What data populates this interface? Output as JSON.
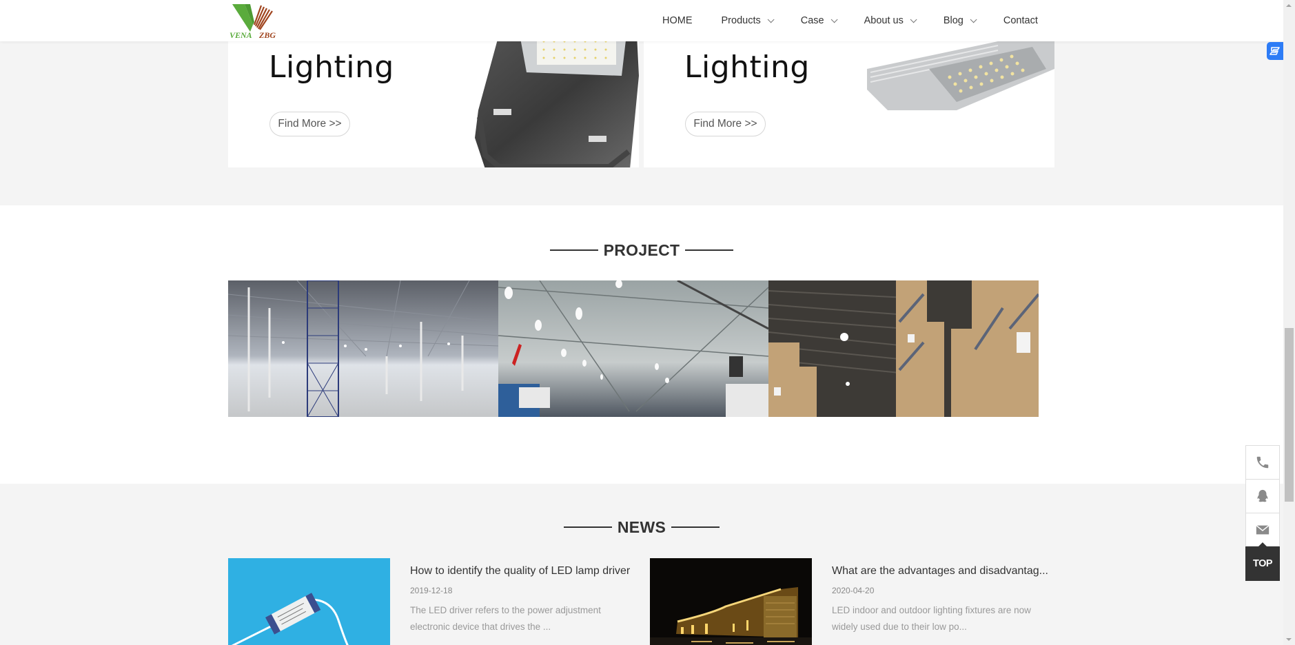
{
  "header": {
    "logo": {
      "text_left": "VENA",
      "text_right": "ZBG",
      "colors": {
        "green": "#5aab3c",
        "brown": "#a0451f"
      }
    },
    "nav": [
      {
        "label": "HOME",
        "has_dropdown": false
      },
      {
        "label": "Products",
        "has_dropdown": true
      },
      {
        "label": "Case",
        "has_dropdown": true
      },
      {
        "label": "About us",
        "has_dropdown": true
      },
      {
        "label": "Blog",
        "has_dropdown": true
      },
      {
        "label": "Contact",
        "has_dropdown": false
      }
    ]
  },
  "product_panels": [
    {
      "headline": "Lighting",
      "button_label": "Find More >>",
      "image": "flood-light-product"
    },
    {
      "headline": "Lighting",
      "button_label": "Find More >>",
      "image": "street-light-product"
    }
  ],
  "project": {
    "title": "PROJECT",
    "images": [
      {
        "alt": "warehouse-steel-structure-lighting"
      },
      {
        "alt": "auto-workshop-high-bay-lighting"
      },
      {
        "alt": "paper-roll-warehouse-lighting"
      }
    ]
  },
  "news": {
    "title": "NEWS",
    "items": [
      {
        "title": "How to identify the quality of LED lamp driver",
        "date": "2019-12-18",
        "excerpt": "The LED driver refers to the power adjustment electronic device that drives the ...",
        "thumb": "led-driver-on-blue"
      },
      {
        "title": "What are the advantages and disadvantag...",
        "date": "2020-04-20",
        "excerpt": "LED indoor and outdoor lighting fixtures are now widely used due to their low po...",
        "thumb": "building-night-lighting"
      }
    ]
  },
  "side_bar": {
    "buttons": [
      {
        "icon": "phone-icon"
      },
      {
        "icon": "qq-penguin-icon"
      },
      {
        "icon": "mail-icon"
      }
    ],
    "top_label": "TOP"
  },
  "colors": {
    "accent_blue": "#2d7cf6",
    "dark": "#333333",
    "bg_gray": "#f4f4f4"
  }
}
